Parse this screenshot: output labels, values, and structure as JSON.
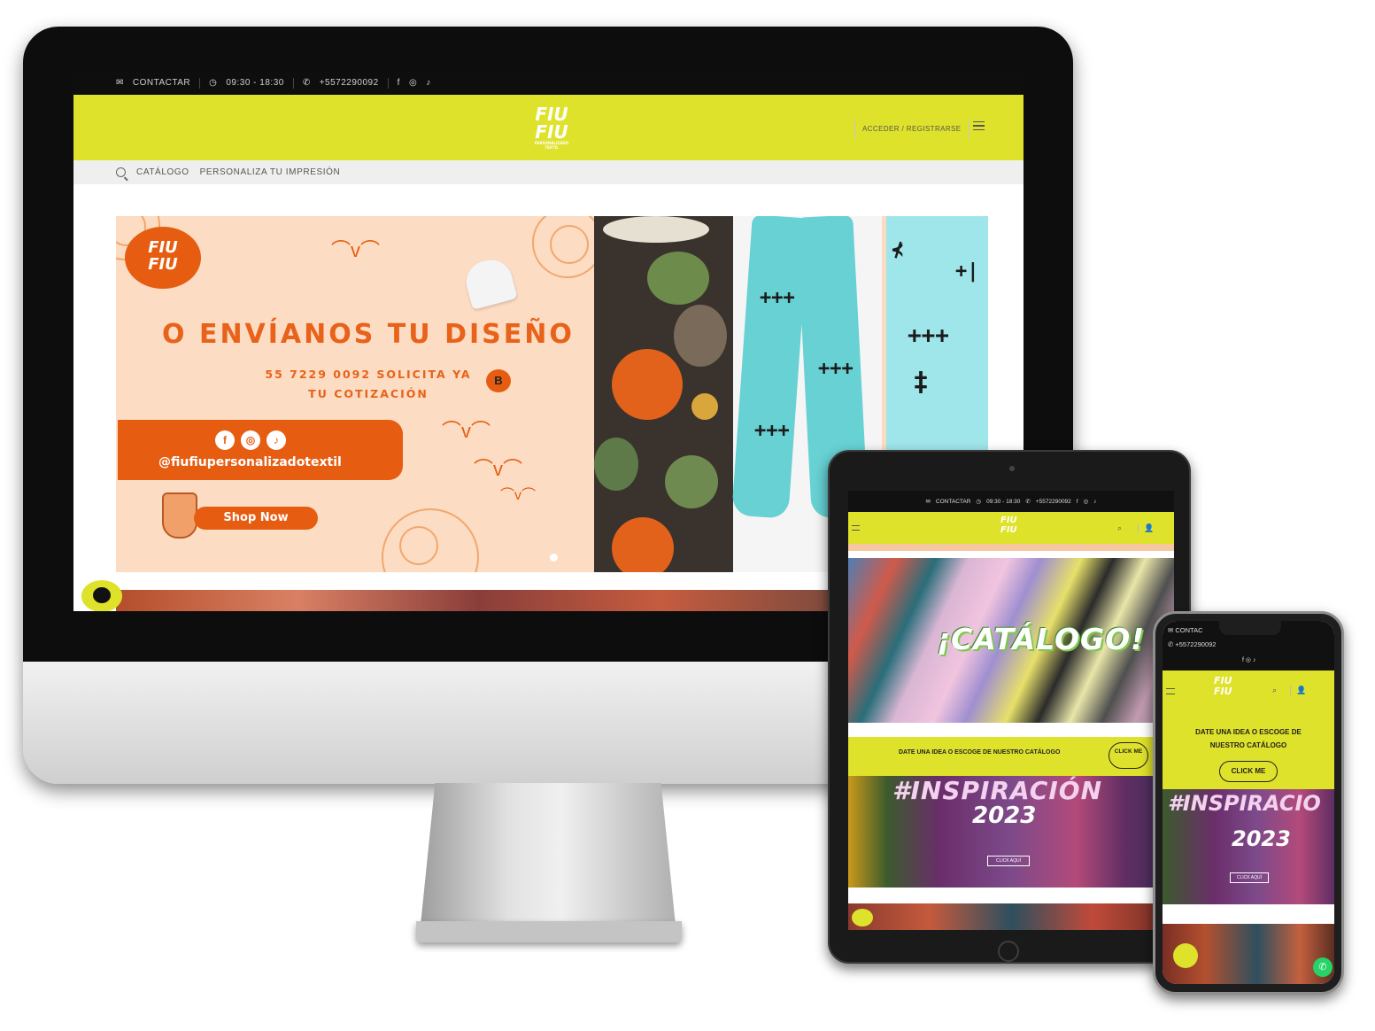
{
  "brand": {
    "logo_line1": "FIU",
    "logo_line2": "FIU",
    "logo_tagline": "PERSONALIZADO TEXTIL",
    "accent": "#dfe22a",
    "orange": "#e65d12"
  },
  "desktop": {
    "topbar": {
      "contact": "CONTACTAR",
      "hours": "09:30 - 18:30",
      "phone": "+5572290092",
      "social_icons": [
        "facebook-icon",
        "instagram-icon",
        "tiktok-icon"
      ]
    },
    "header": {
      "login": "ACCEDER / REGISTRARSE"
    },
    "nav": {
      "items": [
        "CATÁLOGO",
        "PERSONALIZA TU IMPRESIÓN"
      ]
    },
    "banner": {
      "title": "O ENVÍANOS TU DISEÑO",
      "subtitle_line1": "55 7229 0092 SOLICITA YA",
      "subtitle_line2": "TU COTIZACIÓN",
      "handle": "@fiufiupersonalizadotextil",
      "cta": "Shop Now",
      "badge": "B"
    }
  },
  "tablet": {
    "topbar": {
      "contact": "CONTACTAR",
      "hours": "09:30 - 18:30",
      "phone": "+5572290092"
    },
    "catalog_title": "¡CATÁLOGO!",
    "promo_text": "DATE UNA IDEA O ESCOGE DE NUESTRO CATÁLOGO",
    "promo_button": "CLICK ME",
    "inspiration_title": "#INSPIRACIÓN",
    "inspiration_year": "2023",
    "inspiration_button": "CLICK AQUÍ"
  },
  "phone": {
    "topbar": {
      "contact": "CONTAC",
      "phone": "+5572290092"
    },
    "promo_text": "DATE UNA IDEA O ESCOGE DE NUESTRO CATÁLOGO",
    "promo_button": "CLICK ME",
    "inspiration_title": "#INSPIRACIO",
    "inspiration_year": "2023",
    "inspiration_button": "CLICK AQUÍ"
  }
}
